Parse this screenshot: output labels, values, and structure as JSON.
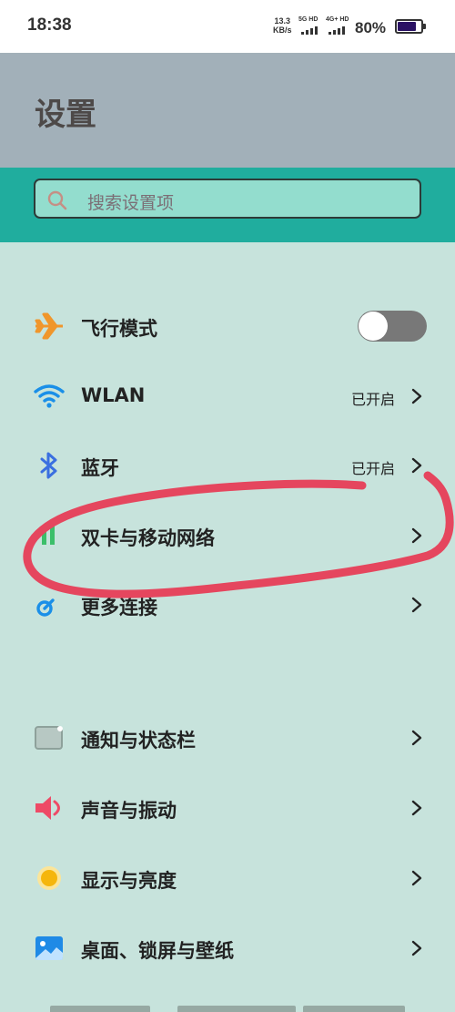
{
  "status_bar": {
    "time": "18:38",
    "net_speed_value": "13.3",
    "net_speed_unit": "KB/s",
    "sim1_label": "5G HD",
    "sim2_label": "4G+ HD",
    "battery_percent": "80%",
    "battery_level": 0.8
  },
  "header": {
    "title": "设置"
  },
  "search": {
    "placeholder": "搜索设置项"
  },
  "settings": {
    "items": [
      {
        "label": "飞行模式",
        "status": "",
        "icon": "airplane-icon",
        "toggle": "off"
      },
      {
        "label": "WLAN",
        "status": "已开启",
        "icon": "wifi-icon"
      },
      {
        "label": "蓝牙",
        "status": "已开启",
        "icon": "bluetooth-icon"
      },
      {
        "label": "双卡与移动网络",
        "status": "",
        "icon": "sim-card-icon"
      },
      {
        "label": "更多连接",
        "status": "",
        "icon": "more-connections-icon"
      },
      {
        "label": "通知与状态栏",
        "status": "",
        "icon": "notification-icon"
      },
      {
        "label": "声音与振动",
        "status": "",
        "icon": "sound-icon"
      },
      {
        "label": "显示与亮度",
        "status": "",
        "icon": "brightness-icon"
      },
      {
        "label": "桌面、锁屏与壁纸",
        "status": "",
        "icon": "wallpaper-icon"
      }
    ]
  },
  "colors": {
    "accent_teal": "#20ad9e",
    "header_bg": "#a2b0b9",
    "content_bg": "#c7e3dc",
    "annotation_red": "#e5465e"
  }
}
